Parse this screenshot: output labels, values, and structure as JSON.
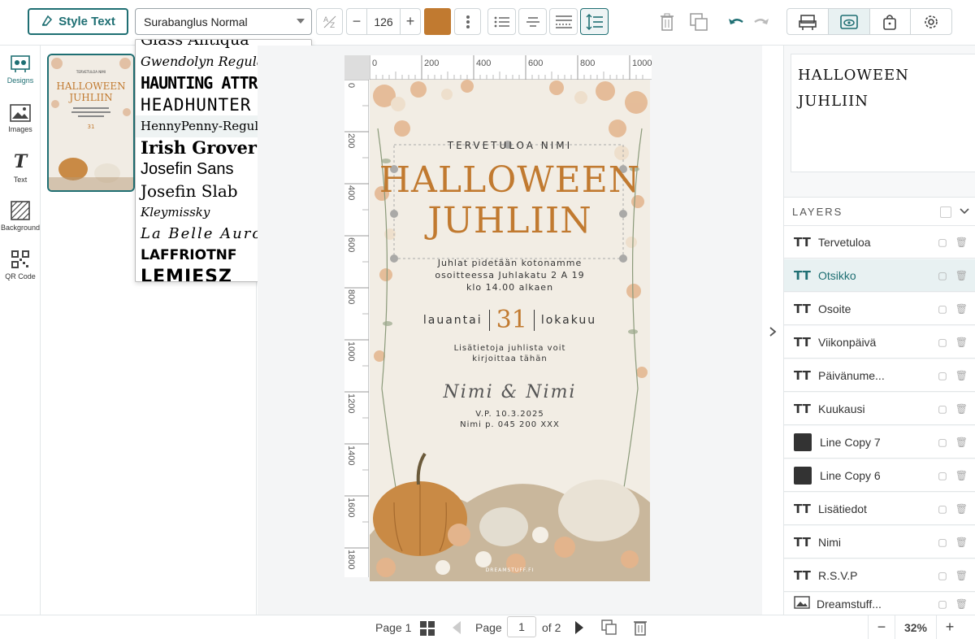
{
  "toolbar": {
    "style_text_label": "Style Text",
    "font_value": "Surabanglus Normal",
    "font_size": "126",
    "color": "#c17a30",
    "minus": "−",
    "plus": "+"
  },
  "font_dropdown": {
    "options": [
      "Glass Antiqua",
      "Gwendolyn Regular",
      "HAUNTING ATTRACTION",
      "HEADHUNTER REGU",
      "HennyPenny-Regular",
      "Irish Grover",
      "Josefin Sans",
      "Josefin Slab",
      "Kleymissky",
      "La Belle Aurore",
      "LAFFRIOTNF",
      "LEMIESZ"
    ]
  },
  "rail": {
    "designs": "Designs",
    "images": "Images",
    "text": "Text",
    "background": "Background",
    "qr": "QR Code"
  },
  "ruler": {
    "h": [
      "0",
      "200",
      "400",
      "600",
      "800",
      "1000"
    ],
    "v": [
      "0",
      "200",
      "400",
      "600",
      "800",
      "1000",
      "1200",
      "1400",
      "1600",
      "1800"
    ]
  },
  "card": {
    "welcome": "TERVETULOA NIMI",
    "title1": "HALLOWEEN",
    "title2": "JUHLIIN",
    "address1": "Juhlat pidetään kotonamme",
    "address2": "osoitteessa Juhlakatu 2 A 19",
    "address3": "klo 14.00 alkaen",
    "weekday": "lauantai",
    "day": "31",
    "month": "lokakuu",
    "info1": "Lisätietoja juhlista voit",
    "info2": "kirjoittaa tähän",
    "names": "Nimi & Nimi",
    "rsvp1": "V.P. 10.3.2025",
    "rsvp2": "Nimi p. 045 200 XXX",
    "brand": "DREAMSTUFF.FI",
    "accent": "#c17a30"
  },
  "preview": {
    "line1": "HALLOWEEN",
    "line2": "JUHLIIN"
  },
  "layers": {
    "heading": "LAYERS",
    "items": [
      "Tervetuloa",
      "Otsikko",
      "Osoite",
      "Viikonpäivä",
      "Päivänume...",
      "Kuukausi",
      "Line Copy 7",
      "Line Copy 6",
      "Lisätiedot",
      "Nimi",
      "R.S.V.P",
      "Dreamstuff..."
    ]
  },
  "bottom": {
    "page_label": "Page 1",
    "page_word": "Page",
    "page_value": "1",
    "of_label": "of 2",
    "zoom": "32%"
  }
}
